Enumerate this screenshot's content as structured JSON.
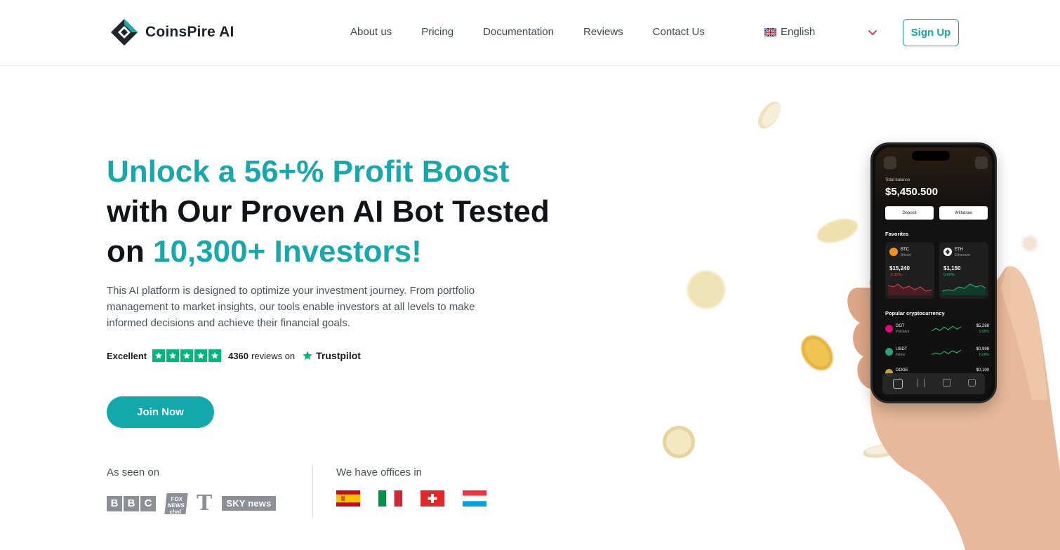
{
  "header": {
    "brand": "CoinsPire AI",
    "nav": [
      "About us",
      "Pricing",
      "Documentation",
      "Reviews",
      "Contact Us"
    ],
    "language": "English",
    "signup_label": "Sign Up"
  },
  "hero": {
    "title_line1_accent": "Unlock a 56+% Profit Boost",
    "title_line2": "with Our Proven AI Bot Tested",
    "title_line3_prefix": "on ",
    "title_line3_accent": "10,300+ Investors!",
    "description": "This AI platform is designed to optimize your investment journey. From portfolio management to market insights, our tools enable investors at all levels to make informed decisions and achieve their financial goals.",
    "rating_label": "Excellent",
    "stars": 5,
    "review_count": "4360",
    "reviews_on": "reviews on",
    "trustpilot": "Trustpilot",
    "join_label": "Join Now"
  },
  "seen_on": {
    "label": "As seen on",
    "logos": [
      "bbc-logo",
      "fox-news-logo",
      "times-logo",
      "sky-news-logo"
    ]
  },
  "offices": {
    "label": "We have offices in",
    "flags": [
      "spain-flag",
      "italy-flag",
      "switzerland-flag",
      "luxembourg-flag"
    ]
  },
  "phone": {
    "total_balance_label": "Total balance",
    "balance": "$5,450.500",
    "deposit": "Deposit",
    "withdraw": "Withdraw",
    "favorites": "Favorites",
    "fav_cards": [
      {
        "symbol": "BTC",
        "name": "Bitcoin",
        "price": "$15,240",
        "change": "-2.35%",
        "trend": "down"
      },
      {
        "symbol": "ETH",
        "name": "Ethereum",
        "price": "$1,150",
        "change": "0.99%",
        "trend": "up"
      }
    ],
    "popular": "Popular cryptocurrency",
    "popular_list": [
      {
        "symbol": "DOT",
        "name": "Polkadot",
        "price": "$5,288",
        "change": "0.99%"
      },
      {
        "symbol": "USDT",
        "name": "Tether",
        "price": "$0,998",
        "change": "0.06%"
      },
      {
        "symbol": "DOGE",
        "name": "",
        "price": "$0,100",
        "change": ""
      }
    ]
  },
  "colors": {
    "accent": "#17a8ab",
    "trustpilot_green": "#00b67a",
    "text_dark": "#101418"
  }
}
